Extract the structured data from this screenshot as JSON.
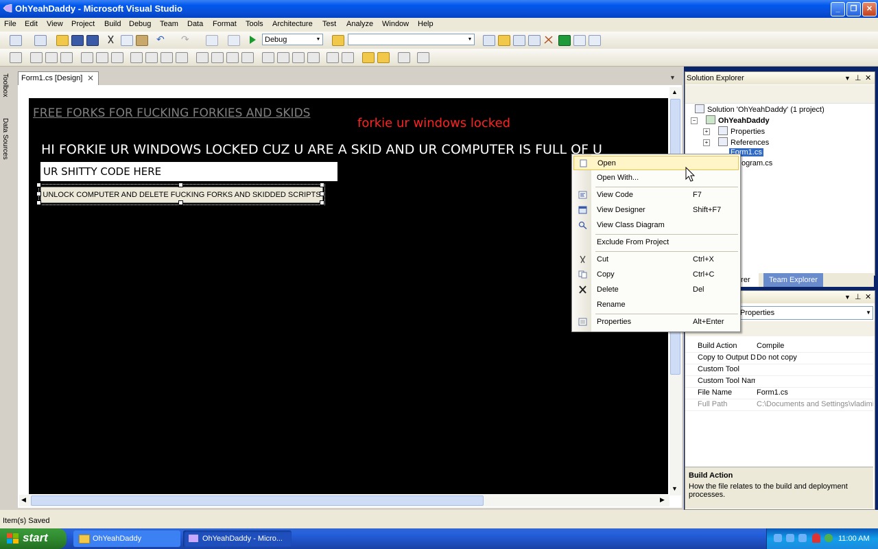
{
  "window": {
    "title": "OhYeahDaddy - Microsoft Visual Studio"
  },
  "menu": [
    "File",
    "Edit",
    "View",
    "Project",
    "Build",
    "Debug",
    "Team",
    "Data",
    "Format",
    "Tools",
    "Architecture",
    "Test",
    "Analyze",
    "Window",
    "Help"
  ],
  "toolbar": {
    "config": "Debug",
    "platform": ""
  },
  "left_dock": {
    "toolbox": "Toolbox",
    "data_sources": "Data Sources"
  },
  "document": {
    "tab": "Form1.cs [Design]",
    "form": {
      "link_label": "FREE FORKS FOR FUCKING FORKIES AND SKIDS",
      "red_label": "forkie ur windows locked",
      "message": "HI FORKIE UR WINDOWS LOCKED CUZ U ARE A SKID AND UR COMPUTER IS FULL OF U",
      "textbox": "UR SHITTY CODE HERE",
      "button": "UNLOCK COMPUTER AND DELETE FUCKING FORKS AND SKIDDED SCRIPTS"
    }
  },
  "solution_explorer": {
    "title": "Solution Explorer",
    "solution": "Solution 'OhYeahDaddy' (1 project)",
    "project": "OhYeahDaddy",
    "items": [
      "Properties",
      "References",
      "Form1.cs",
      "Program.cs"
    ],
    "tabs": [
      "Solution Explorer",
      "Team Explorer"
    ],
    "visible_tab_fragment": "xplorer",
    "visible_item_fragment": "ogram.cs"
  },
  "properties": {
    "object": "Properties",
    "rows": [
      {
        "key": "Build Action",
        "value": "Compile"
      },
      {
        "key": "Copy to Output D",
        "value": "Do not copy"
      },
      {
        "key": "Custom Tool",
        "value": ""
      },
      {
        "key": "Custom Tool Nam",
        "value": ""
      },
      {
        "key": "File Name",
        "value": "Form1.cs"
      },
      {
        "key": "Full Path",
        "value": "C:\\Documents and Settings\\vladimi"
      }
    ],
    "desc_title": "Build Action",
    "desc_text": "How the file relates to the build and deployment processes."
  },
  "context_menu": {
    "items": [
      {
        "label": "Open",
        "shortcut": ""
      },
      {
        "label": "Open With...",
        "shortcut": ""
      },
      {
        "label": "View Code",
        "shortcut": "F7"
      },
      {
        "label": "View Designer",
        "shortcut": "Shift+F7"
      },
      {
        "label": "View Class Diagram",
        "shortcut": ""
      },
      {
        "label": "Exclude From Project",
        "shortcut": ""
      },
      {
        "label": "Cut",
        "shortcut": "Ctrl+X"
      },
      {
        "label": "Copy",
        "shortcut": "Ctrl+C"
      },
      {
        "label": "Delete",
        "shortcut": "Del"
      },
      {
        "label": "Rename",
        "shortcut": ""
      },
      {
        "label": "Properties",
        "shortcut": "Alt+Enter"
      }
    ]
  },
  "status": "Item(s) Saved",
  "taskbar": {
    "start": "start",
    "tasks": [
      "OhYeahDaddy",
      "OhYeahDaddy - Micro..."
    ],
    "clock": "11:00 AM"
  },
  "colors": {
    "form_bg": "#000000",
    "red_label": "#ff2020",
    "highlight": "#fff5c7"
  }
}
